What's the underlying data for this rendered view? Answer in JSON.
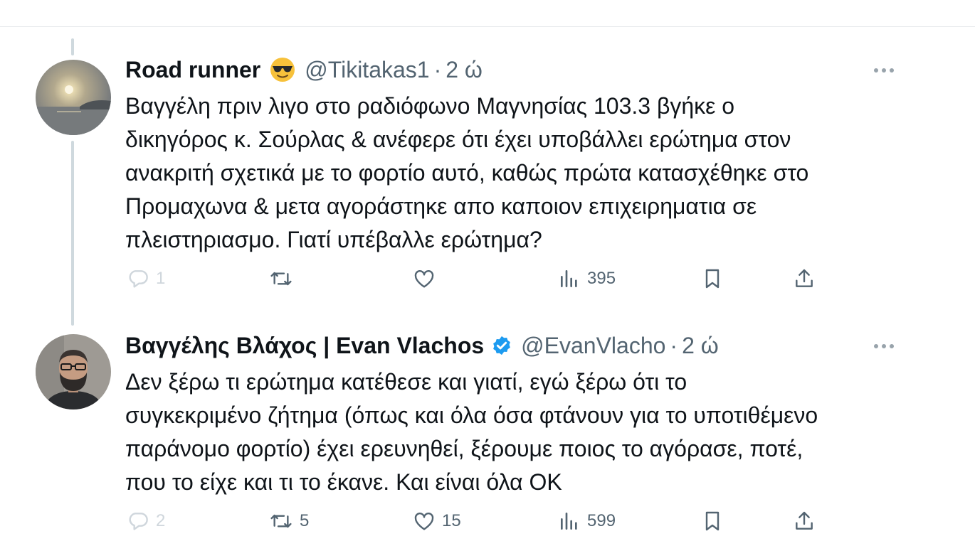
{
  "tweets": [
    {
      "display_name": "Road runner",
      "emoji": "😎",
      "handle": "@Tikitakas1",
      "separator": "·",
      "time": "2 ώ",
      "text_lines": [
        "Βαγγέλη πριν λιγο στο ραδιόφωνο Μαγνησίας 103.3 βγήκε ο",
        "δικηγόρος κ. Σούρλας & ανέφερε ότι έχει υποβάλλει ερώτημα στον",
        "ανακριτή σχετικά με το φορτίο αυτό, καθώς πρώτα κατασχέθηκε στο",
        "Προμαχωνα & μετα αγοράστηκε απο καποιον επιχειρηματια σε",
        "πλειστηριασμο. Γιατί υπέβαλλε ερώτημα?"
      ],
      "reply_count": "1",
      "retweet_count": "",
      "like_count": "",
      "view_count": "395"
    },
    {
      "display_name": "Βαγγέλης Βλάχος | Evan Vlachos",
      "verified": true,
      "handle": "@EvanVlacho",
      "separator": "·",
      "time": "2 ώ",
      "text_lines": [
        "Δεν ξέρω τι ερώτημα κατέθεσε και γιατί, εγώ ξέρω ότι το",
        "συγκεκριμένο ζήτημα (όπως και όλα όσα φτάνουν για το υποτιθέμενο",
        "παράνομο φορτίο) έχει ερευνηθεί, ξέρουμε ποιος το αγόρασε, ποτέ,",
        "που το είχε και τι το έκανε. Και είναι όλα ΟΚ"
      ],
      "reply_count": "2",
      "retweet_count": "5",
      "like_count": "15",
      "view_count": "599"
    }
  ],
  "icons": {
    "reply": "reply-icon",
    "retweet": "retweet-icon",
    "like": "heart-icon",
    "views": "views-icon",
    "bookmark": "bookmark-icon",
    "share": "share-icon",
    "more": "more-icon",
    "verified": "verified-badge-icon"
  },
  "colors": {
    "text": "#0f1419",
    "secondary": "#536471",
    "verified": "#1d9bf0",
    "thread_line": "#cfd9de"
  }
}
